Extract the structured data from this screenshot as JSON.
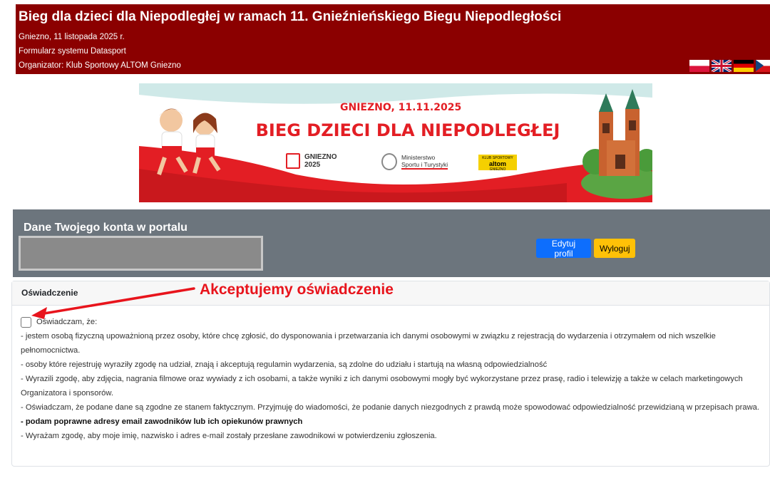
{
  "header": {
    "title": "Bieg dla dzieci dla Niepodległej w ramach 11. Gnieźnieńskiego Biegu Niepodległości",
    "location_date": "Gniezno, 11 listopada 2025 r.",
    "form_system": "Formularz systemu Datasport",
    "organizer": "Organizator: Klub Sportowy ALTOM Gniezno"
  },
  "languages": [
    "pl",
    "en",
    "de",
    "cz"
  ],
  "banner": {
    "date_text": "GNIEZNO, 11.11.2025",
    "headline": "BIEG DZIECI DLA NIEPODLEGŁEJ",
    "logo_gniezno": "GNIEZNO 2025",
    "logo_ministry_line1": "Ministerstwo",
    "logo_ministry_line2": "Sportu i Turystyki",
    "logo_altom_small": "KLUB SPORTOWY",
    "logo_altom": "altom",
    "logo_altom_city": "GNIEZNO",
    "colors": {
      "red": "#e31e24",
      "sky": "#cfe9e8",
      "green": "#4a9b3a"
    }
  },
  "account": {
    "title": "Dane Twojego konta w portalu",
    "edit_button": "Edytuj profil",
    "logout_button": "Wyloguj"
  },
  "declaration": {
    "header": "Oświadczenie",
    "checkbox_label": "Oświadczam, że:",
    "checked": false,
    "paragraphs": [
      "- jestem osobą fizyczną upoważnioną przez osoby, które chcę zgłosić, do dysponowania i przetwarzania ich danymi osobowymi w związku z rejestracją do wydarzenia i otrzymałem od nich wszelkie pełnomocnictwa.",
      "- osoby które rejestruję wyraziły zgodę na udział, znają i akceptują regulamin wydarzenia, są zdolne do udziału i startują na własną odpowiedzialność",
      "- Wyrazili zgodę, aby zdjęcia, nagrania filmowe oraz wywiady z ich osobami, a także wyniki z ich danymi osobowymi mogły być wykorzystane przez prasę, radio i telewizję a także w celach marketingowych Organizatora i sponsorów.",
      "- Oświadczam, że podane dane są zgodne ze stanem faktycznym. Przyjmuję do wiadomości, że podanie danych niezgodnych z prawdą może spowodować odpowiedzialność przewidzianą w przepisach prawa."
    ],
    "bold_paragraph": "- podam poprawne adresy email zawodników lub ich opiekunów prawnych",
    "last_paragraph": "- Wyrażam zgodę, aby moje imię, nazwisko i adres e-mail zostały przesłane zawodnikowi w potwierdzeniu zgłoszenia."
  },
  "annotation": {
    "text": "Akceptujemy oświadczenie",
    "color": "#e8141c"
  }
}
